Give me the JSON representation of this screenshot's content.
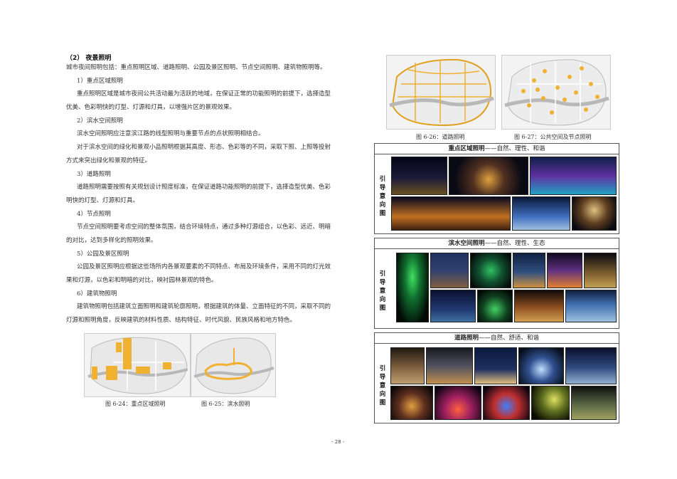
{
  "section": {
    "heading": "（2）   夜景照明"
  },
  "paragraphs": [
    "城市夜间照明包括：重点照明区域、道路照明、公园及景区照明、节点空间照明、建筑物照明等。",
    "1）重点区域照明",
    "重点照明区域是城市夜间公共活动最为活跃的地域，在保证正常的功能照明的前提下，选择造型",
    "优美、色彩明快的灯型、灯源和灯具，以增强片区的景观效果。",
    "2）滨水空间照明",
    "滨水空间照明应注意滨江路的线型照明与重要节点的点状照明相结合。",
    "对于滨水空间的绿化和景观小品照明根据其高度、形态、色彩等的不同，采取下照、上照等投射",
    "方式来突出绿化和景观的特征。",
    "3）道路照明",
    "道路照明需要按照有关规划设计照度标准，在保证道路功能照明的前提下，选择造型优美、色彩",
    "明快的灯型、灯源和灯具。",
    "4）节点照明",
    "节点空间照明要考虑空间的整体氛围，结合环境特点，通过多种灯源组合，以色彩、远近、明暗",
    "的对比，达到多样化的照明效果。",
    "5）公园及景区照明",
    "公园及景区照明应根据这些场所内各景观要素的不同特点、布局及环境条件，采用不同的灯光效",
    "果和灯源，以色彩和明暗的对比，映衬园林景观的特色。",
    "6）建筑物照明",
    "建筑物照明包括建筑立面照明和建筑轮廓照明，根据建筑的体量、立面特征的不同，采取不同的",
    "灯源和照明角度，反映建筑的材料性质、结构特征、时代风貌、民族风格和地方特色。"
  ],
  "captions": {
    "fig24": "图 6-24：重点区域照明",
    "fig25": "图 6-25：滨水照明",
    "fig26": "图 6-26：道路照明",
    "fig27": "图 6-27：公共空间及节点照明"
  },
  "panels": [
    {
      "title_bold": "重点区域照明",
      "title_rest": "——自然、理性、和谐",
      "side": [
        "引",
        "导",
        "意",
        "向",
        "图"
      ]
    },
    {
      "title_bold": "滨水空间照明",
      "title_rest": "——自然、理性、生态",
      "side": [
        "引",
        "导",
        "意",
        "向",
        "图"
      ]
    },
    {
      "title_bold": "道路照明",
      "title_rest": "——自然、舒适、和谐",
      "side": [
        "引",
        "导",
        "意",
        "向",
        "图"
      ]
    }
  ],
  "page_number": "- 28 -",
  "colors": {
    "highlight_orange": "#f0b030",
    "river_grey": "#b8b8b8",
    "night": "#0a0a1a"
  }
}
